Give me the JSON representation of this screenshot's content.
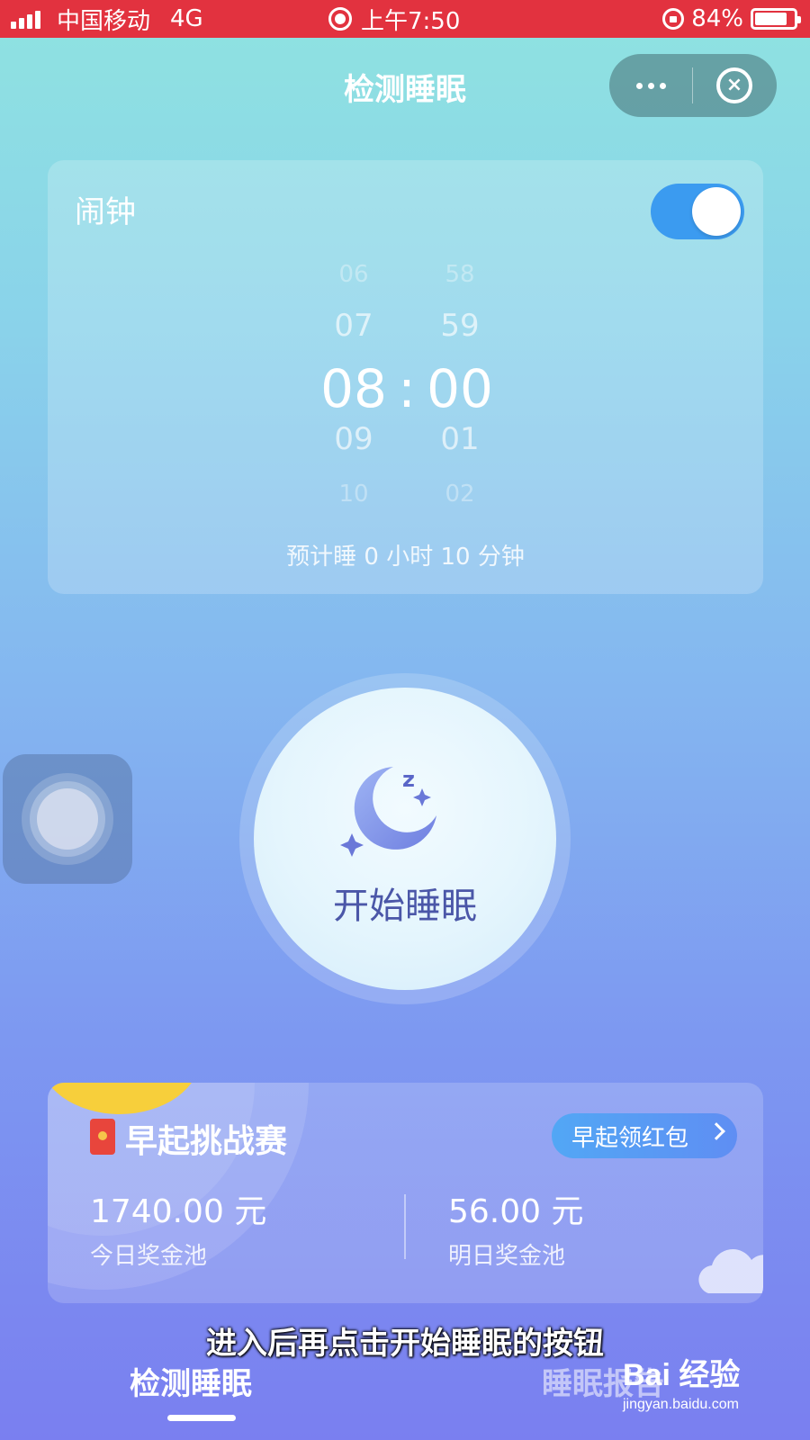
{
  "status_bar": {
    "carrier": "中国移动",
    "network": "4G",
    "time": "上午7:50",
    "battery": "84%",
    "battery_level": 0.84
  },
  "nav": {
    "title": "检测睡眠",
    "more_icon": "more-dots-icon",
    "close_icon": "close-circle-icon"
  },
  "alarm": {
    "label": "闹钟",
    "enabled": true,
    "hours": [
      "06",
      "07",
      "08",
      "09",
      "10"
    ],
    "minutes": [
      "58",
      "59",
      "00",
      "01",
      "02"
    ],
    "separator": ":",
    "estimate": "预计睡 0 小时 10 分钟"
  },
  "start_sleep": {
    "label": "开始睡眠",
    "icon": "moon-sleep-icon"
  },
  "challenge": {
    "title": "早起挑战赛",
    "bonus_button": "早起领红包",
    "today_amount": "1740.00 元",
    "today_label": "今日奖金池",
    "tomorrow_amount": "56.00 元",
    "tomorrow_label": "明日奖金池"
  },
  "subtitle": "进入后再点击开始睡眠的按钮",
  "tabs": {
    "active": "检测睡眠",
    "inactive": "睡眠报告"
  },
  "watermark": {
    "main": "Bai 经验",
    "sub": "jingyan.baidu.com"
  },
  "colors": {
    "status_bar": "#e2323f",
    "toggle_on": "#3b9bf0",
    "start_text": "#4b57a8",
    "sun": "#f7cf3b"
  }
}
